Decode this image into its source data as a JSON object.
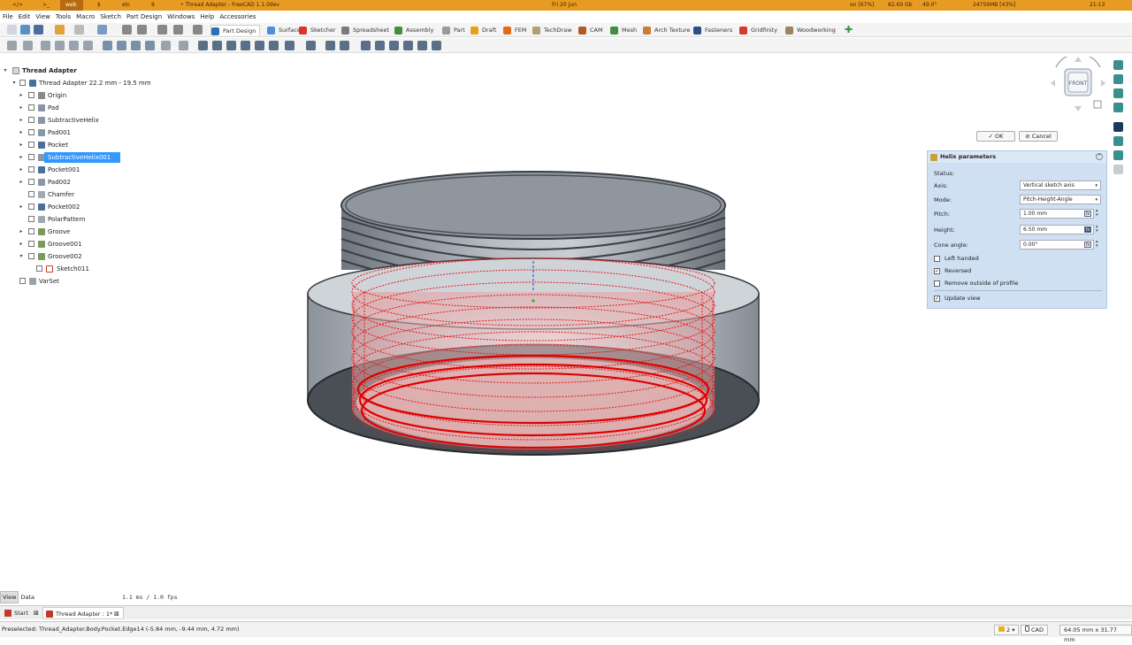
{
  "topbar": {
    "workspaces": [
      "</>",
      ">_",
      "web",
      "$",
      "etc",
      "8"
    ],
    "window_title": "• Thread Adapter - FreeCAD 1.1.0dev",
    "clock_date": "Fri 20 Jun",
    "indicators": [
      "on [67%]",
      "82.69 Gb",
      "49.0°",
      "24756MB [43%]",
      "21:13"
    ]
  },
  "menu": [
    "File",
    "Edit",
    "View",
    "Tools",
    "Macro",
    "Sketch",
    "Part Design",
    "Windows",
    "Help",
    "Accessories"
  ],
  "workbenches": [
    {
      "label": "Part Design",
      "icon": "partdesign-icon",
      "color": "#2c6fb5"
    },
    {
      "label": "Surface",
      "icon": "surface-icon",
      "color": "#4a90d9"
    },
    {
      "label": "Sketcher",
      "icon": "sketcher-icon",
      "color": "#d9342b"
    },
    {
      "label": "Spreadsheet",
      "icon": "spreadsheet-icon",
      "color": "#7a7a7a"
    },
    {
      "label": "Assembly",
      "icon": "assembly-icon",
      "color": "#3f8f3f"
    },
    {
      "label": "Part",
      "icon": "part-icon",
      "color": "#9a9a9a"
    },
    {
      "label": "Draft",
      "icon": "draft-icon",
      "color": "#e3a21a"
    },
    {
      "label": "FEM",
      "icon": "fem-icon",
      "color": "#e06c1a"
    },
    {
      "label": "TechDraw",
      "icon": "techdraw-icon",
      "color": "#b0a070"
    },
    {
      "label": "CAM",
      "icon": "cam-icon",
      "color": "#b05a2a"
    },
    {
      "label": "Mesh",
      "icon": "mesh-icon",
      "color": "#3f8f3f"
    },
    {
      "label": "Arch Texture",
      "icon": "archtexture-icon",
      "color": "#c97f3a"
    },
    {
      "label": "Fasteners",
      "icon": "fasteners-icon",
      "color": "#2c4f8a"
    },
    {
      "label": "Gridfinity",
      "icon": "gridfinity-icon",
      "color": "#d23a2a"
    },
    {
      "label": "Woodworking",
      "icon": "woodworking-icon",
      "color": "#9a8560"
    }
  ],
  "tree": {
    "root": "Thread Adapter",
    "body": "Thread Adapter 22.2 mm - 19.5 mm",
    "items": [
      {
        "label": "Origin",
        "icon": "origin-icon",
        "expand": true,
        "selected": false
      },
      {
        "label": "Pad",
        "icon": "pad-icon",
        "expand": true,
        "selected": false
      },
      {
        "label": "SubtractiveHelix",
        "icon": "helix-icon",
        "expand": true,
        "selected": false
      },
      {
        "label": "Pad001",
        "icon": "pad-icon",
        "expand": true,
        "selected": false
      },
      {
        "label": "Pocket",
        "icon": "pocket-icon",
        "expand": true,
        "selected": false
      },
      {
        "label": "SubtractiveHelix001",
        "icon": "helix-icon",
        "expand": true,
        "selected": true
      },
      {
        "label": "Pocket001",
        "icon": "pocket-icon",
        "expand": true,
        "selected": false
      },
      {
        "label": "Pad002",
        "icon": "pad-icon",
        "expand": true,
        "selected": false
      },
      {
        "label": "Chamfer",
        "icon": "chamfer-icon",
        "expand": false,
        "selected": false
      },
      {
        "label": "Pocket002",
        "icon": "pocket-icon",
        "expand": true,
        "selected": false
      },
      {
        "label": "PolarPattern",
        "icon": "polarpattern-icon",
        "expand": false,
        "selected": false
      },
      {
        "label": "Groove",
        "icon": "groove-icon",
        "expand": true,
        "selected": false
      },
      {
        "label": "Groove001",
        "icon": "groove-icon",
        "expand": true,
        "selected": false
      },
      {
        "label": "Groove002",
        "icon": "groove-icon",
        "expand": "open",
        "selected": false
      }
    ],
    "sub_item": "Sketch011",
    "varset": "VarSet"
  },
  "dialog": {
    "ok": "✓ OK",
    "cancel": "⊘ Cancel"
  },
  "helix": {
    "title": "Helix parameters",
    "status_label": "Status:",
    "axis_label": "Axis:",
    "axis_value": "Vertical sketch axis",
    "mode_label": "Mode:",
    "mode_value": "Pitch-Height-Angle",
    "pitch_label": "Pitch:",
    "pitch_value": "1.00 mm",
    "height_label": "Height:",
    "height_value": "6.50 mm",
    "cone_label": "Cone angle:",
    "cone_value": "0.00°",
    "fx": "fx",
    "left_handed_label": "Left handed",
    "left_handed": false,
    "reversed_label": "Reversed",
    "reversed": true,
    "remove_outside_label": "Remove outside of profile",
    "remove_outside": false,
    "update_view_label": "Update view",
    "update_view": true
  },
  "navcube": {
    "face": "FRONT"
  },
  "bottom_tabs": [
    "View",
    "Data"
  ],
  "fps": "1.1 ms / 1.0 fps",
  "doc_tabs": [
    "Start",
    "Thread Adapter : 1*"
  ],
  "status": {
    "text": "Preselected: Thread_Adapter.Body.Pocket.Edge14 (-5.84 mm, -9.44 mm, 4.72 mm)",
    "count": "2",
    "nav_style": "CAD",
    "dims": "64.05 mm x 31.77 mm"
  }
}
